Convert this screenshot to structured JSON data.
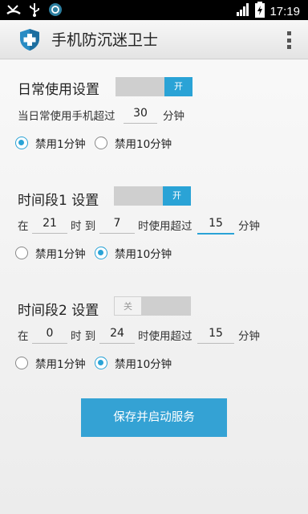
{
  "status_bar": {
    "time": "17:19",
    "icons": [
      "missed-call-icon",
      "usb-icon",
      "sync-icon",
      "signal-icon",
      "battery-charging-icon"
    ]
  },
  "action_bar": {
    "title": "手机防沉迷卫士",
    "logo_icon": "shield-cross-icon",
    "menu_icon": "overflow-menu-icon"
  },
  "daily": {
    "title": "日常使用设置",
    "toggle": "开",
    "enabled": true,
    "prefix": "当日常使用手机超过",
    "minutes": "30",
    "unit": "分钟",
    "option1": "禁用1分钟",
    "option2": "禁用10分钟",
    "selected": 1
  },
  "period1": {
    "title": "时间段1 设置",
    "toggle": "开",
    "enabled": true,
    "at": "在",
    "start": "21",
    "hour_to": "时 到",
    "end": "7",
    "over": "时使用超过",
    "minutes": "15",
    "unit": "分钟",
    "option1": "禁用1分钟",
    "option2": "禁用10分钟",
    "selected": 2
  },
  "period2": {
    "title": "时间段2 设置",
    "toggle": "关",
    "enabled": false,
    "at": "在",
    "start": "0",
    "hour_to": "时 到",
    "end": "24",
    "over": "时使用超过",
    "minutes": "15",
    "unit": "分钟",
    "option1": "禁用1分钟",
    "option2": "禁用10分钟",
    "selected": 2
  },
  "save_button": "保存并启动服务",
  "colors": {
    "accent": "#2aa3d6",
    "button": "#34a2d4",
    "status_bar": "#000000"
  }
}
